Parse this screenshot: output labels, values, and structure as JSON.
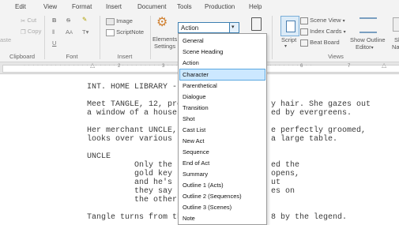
{
  "tabs": [
    "Edit",
    "View",
    "Format",
    "Insert",
    "Document",
    "Tools",
    "Production",
    "Help"
  ],
  "clipboard": {
    "cut": "Cut",
    "copy": "Copy",
    "paste": "aste",
    "label": "Clipboard"
  },
  "font": {
    "bold": "B",
    "strike": "S",
    "underline": "U",
    "size": "A",
    "label": "Font"
  },
  "insert": {
    "image": "Image",
    "scriptnote": "ScriptNote",
    "label": "Insert"
  },
  "elements": {
    "line1": "Elements",
    "line2": "Settings",
    "label": "S"
  },
  "element_combo": {
    "value": "Action"
  },
  "views": {
    "scene_view": "Scene View",
    "index_cards": "Index Cards",
    "beat_board": "Beat Board",
    "script": "Script",
    "show_outline_1": "Show Outline",
    "show_outline_2": "Editor",
    "sh_1": "Sh",
    "sh_2": "Nav",
    "label": "Views"
  },
  "ruler": {
    "marks": [
      "2",
      "3",
      "6",
      "7"
    ]
  },
  "menu": {
    "items": [
      "General",
      "Scene Heading",
      "Action",
      "Character",
      "Parenthetical",
      "Dialogue",
      "Transition",
      "Shot",
      "Cast List",
      "New Act",
      "Sequence",
      "End of Act",
      "Summary",
      "Outline 1 (Acts)",
      "Outline 2 (Sequences)",
      "Outline 3 (Scenes)",
      "Note"
    ],
    "selected": "Character"
  },
  "document": {
    "heading": "INT. HOME LIBRARY -",
    "a1_left": "Meet TANGLE, 12, pre",
    "a1_right": "y hair. She gazes out",
    "a2_left": "a window of a house",
    "a2_right": "ed by evergreens.",
    "b1_left": "Her merchant UNCLE,",
    "b1_right": "e perfectly groomed,",
    "b2_left": "looks over various",
    "b2_right": "a large table.",
    "character": "UNCLE",
    "d1_left": "Only the",
    "d1_right": "ed the",
    "d2_left": "gold key",
    "d2_right": "opens,",
    "d3_left": "and he's",
    "d3_right": "ut",
    "d4_left": "they say",
    "d4_right": "es on",
    "d5_left": "the other",
    "e1_left": "Tangle turns from th",
    "e1_right": "8 by the legend."
  }
}
